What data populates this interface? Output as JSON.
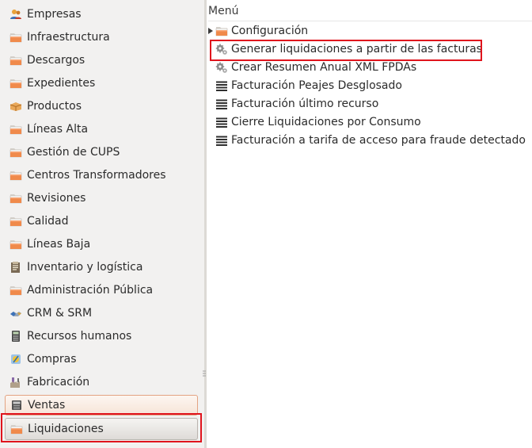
{
  "sidebar": {
    "items": [
      {
        "label": "Empresas",
        "icon": "users-icon"
      },
      {
        "label": "Infraestructura",
        "icon": "folder-icon"
      },
      {
        "label": "Descargos",
        "icon": "folder-icon"
      },
      {
        "label": "Expedientes",
        "icon": "folder-icon"
      },
      {
        "label": "Productos",
        "icon": "box-icon"
      },
      {
        "label": "Líneas Alta",
        "icon": "folder-icon"
      },
      {
        "label": "Gestión de CUPS",
        "icon": "folder-icon"
      },
      {
        "label": "Centros Transformadores",
        "icon": "folder-icon"
      },
      {
        "label": "Revisiones",
        "icon": "folder-icon"
      },
      {
        "label": "Calidad",
        "icon": "folder-icon"
      },
      {
        "label": "Líneas Baja",
        "icon": "folder-icon"
      },
      {
        "label": "Inventario y logística",
        "icon": "inventory-icon"
      },
      {
        "label": "Administración Pública",
        "icon": "folder-icon"
      },
      {
        "label": "CRM & SRM",
        "icon": "handshake-icon"
      },
      {
        "label": "Recursos humanos",
        "icon": "calculator-icon"
      },
      {
        "label": "Compras",
        "icon": "purchases-icon"
      },
      {
        "label": "Fabricación",
        "icon": "factory-icon"
      },
      {
        "label": "Ventas",
        "icon": "cash-register-icon"
      },
      {
        "label": "Liquidaciones",
        "icon": "folder-icon"
      }
    ]
  },
  "menu": {
    "header": "Menú",
    "items": [
      {
        "label": "Configuración",
        "icon": "folder-icon",
        "expandable": true
      },
      {
        "label": "Generar liquidaciones a partir de las facturas",
        "icon": "gears-icon",
        "expandable": false
      },
      {
        "label": "Crear Resumen Anual XML FPDAs",
        "icon": "gears-icon",
        "expandable": false
      },
      {
        "label": "Facturación Peajes Desglosado",
        "icon": "list-icon",
        "expandable": false
      },
      {
        "label": "Facturación último recurso",
        "icon": "list-icon",
        "expandable": false
      },
      {
        "label": "Cierre Liquidaciones por Consumo",
        "icon": "list-icon",
        "expandable": false
      },
      {
        "label": "Facturación a tarifa de acceso para fraude detectado",
        "icon": "list-icon",
        "expandable": false
      }
    ]
  },
  "colors": {
    "highlight_border": "#e0141d",
    "folder_orange": "#f08a4b",
    "hover_border": "#e3a382"
  }
}
